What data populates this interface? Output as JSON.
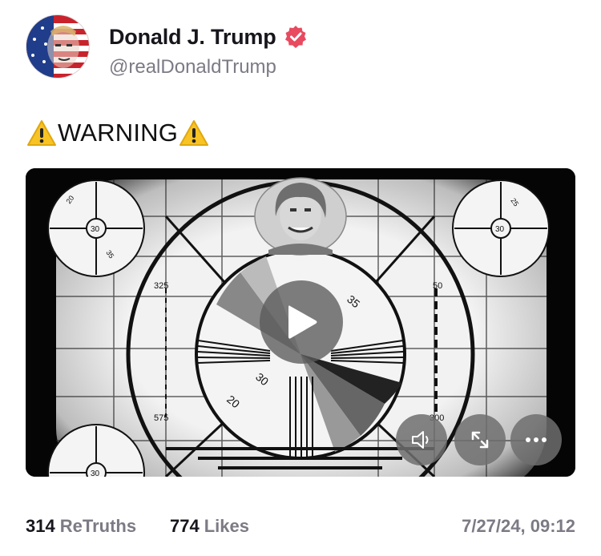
{
  "author": {
    "name": "Donald J. Trump",
    "handle": "@realDonaldTrump",
    "verified": true,
    "avatar": "avatar-portrait"
  },
  "post": {
    "text": "WARNING",
    "leading_emoji": "warning-icon",
    "trailing_emoji": "warning-icon"
  },
  "media": {
    "type": "video",
    "test_pattern_labels": {
      "n325": "325",
      "n50": "50",
      "n575": "575",
      "n300": "300",
      "w35": "35",
      "w30": "30",
      "w20": "20",
      "c30": "30",
      "c20": "20",
      "c25": "25",
      "c35": "35"
    },
    "controls": [
      "play-icon",
      "volume-icon",
      "fullscreen-icon",
      "more-icon"
    ]
  },
  "stats": {
    "retruths_count": "314",
    "retruths_label": "ReTruths",
    "likes_count": "774",
    "likes_label": "Likes"
  },
  "timestamp": "7/27/24, 09:12",
  "colors": {
    "verified": "#e84a5f",
    "secondary_text": "#7d7a85",
    "primary_text": "#16161c"
  }
}
